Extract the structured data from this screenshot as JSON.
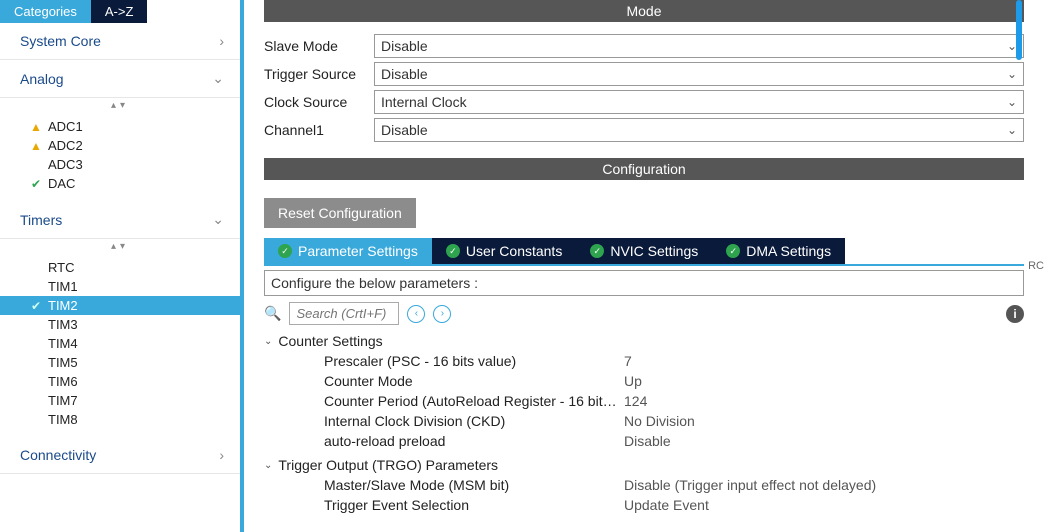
{
  "sidebar": {
    "tabs": {
      "categories": "Categories",
      "az": "A->Z"
    },
    "sections": {
      "system_core": {
        "label": "System Core"
      },
      "analog": {
        "label": "Analog",
        "items": [
          {
            "label": "ADC1",
            "icon": "warn"
          },
          {
            "label": "ADC2",
            "icon": "warn"
          },
          {
            "label": "ADC3",
            "icon": ""
          },
          {
            "label": "DAC",
            "icon": "ok"
          }
        ]
      },
      "timers": {
        "label": "Timers",
        "items": [
          {
            "label": "RTC",
            "icon": ""
          },
          {
            "label": "TIM1",
            "icon": ""
          },
          {
            "label": "TIM2",
            "icon": "ok",
            "selected": true
          },
          {
            "label": "TIM3",
            "icon": ""
          },
          {
            "label": "TIM4",
            "icon": ""
          },
          {
            "label": "TIM5",
            "icon": ""
          },
          {
            "label": "TIM6",
            "icon": ""
          },
          {
            "label": "TIM7",
            "icon": ""
          },
          {
            "label": "TIM8",
            "icon": ""
          }
        ]
      },
      "connectivity": {
        "label": "Connectivity"
      }
    }
  },
  "mode": {
    "title": "Mode",
    "rows": {
      "slave": {
        "label": "Slave Mode",
        "value": "Disable"
      },
      "trigger": {
        "label": "Trigger Source",
        "value": "Disable"
      },
      "clock": {
        "label": "Clock Source",
        "value": "Internal Clock"
      },
      "ch1": {
        "label": "Channel1",
        "value": "Disable"
      }
    }
  },
  "config": {
    "title": "Configuration",
    "reset": "Reset Configuration",
    "tabs": {
      "param": "Parameter Settings",
      "user": "User Constants",
      "nvic": "NVIC Settings",
      "dma": "DMA Settings"
    },
    "hint": "Configure the below parameters :",
    "search_placeholder": "Search (CrtI+F)",
    "groups": {
      "counter": {
        "label": "Counter Settings",
        "rows": [
          {
            "name": "Prescaler (PSC - 16 bits value)",
            "value": "7"
          },
          {
            "name": "Counter Mode",
            "value": "Up"
          },
          {
            "name": "Counter Period (AutoReload Register - 16 bit…",
            "value": "124"
          },
          {
            "name": "Internal Clock Division (CKD)",
            "value": "No Division"
          },
          {
            "name": "auto-reload preload",
            "value": "Disable"
          }
        ]
      },
      "trgo": {
        "label": "Trigger Output (TRGO) Parameters",
        "rows": [
          {
            "name": "Master/Slave Mode (MSM bit)",
            "value": "Disable (Trigger input effect not delayed)"
          },
          {
            "name": "Trigger Event Selection",
            "value": "Update Event"
          }
        ]
      }
    }
  },
  "rail": {
    "rc": "RC"
  }
}
